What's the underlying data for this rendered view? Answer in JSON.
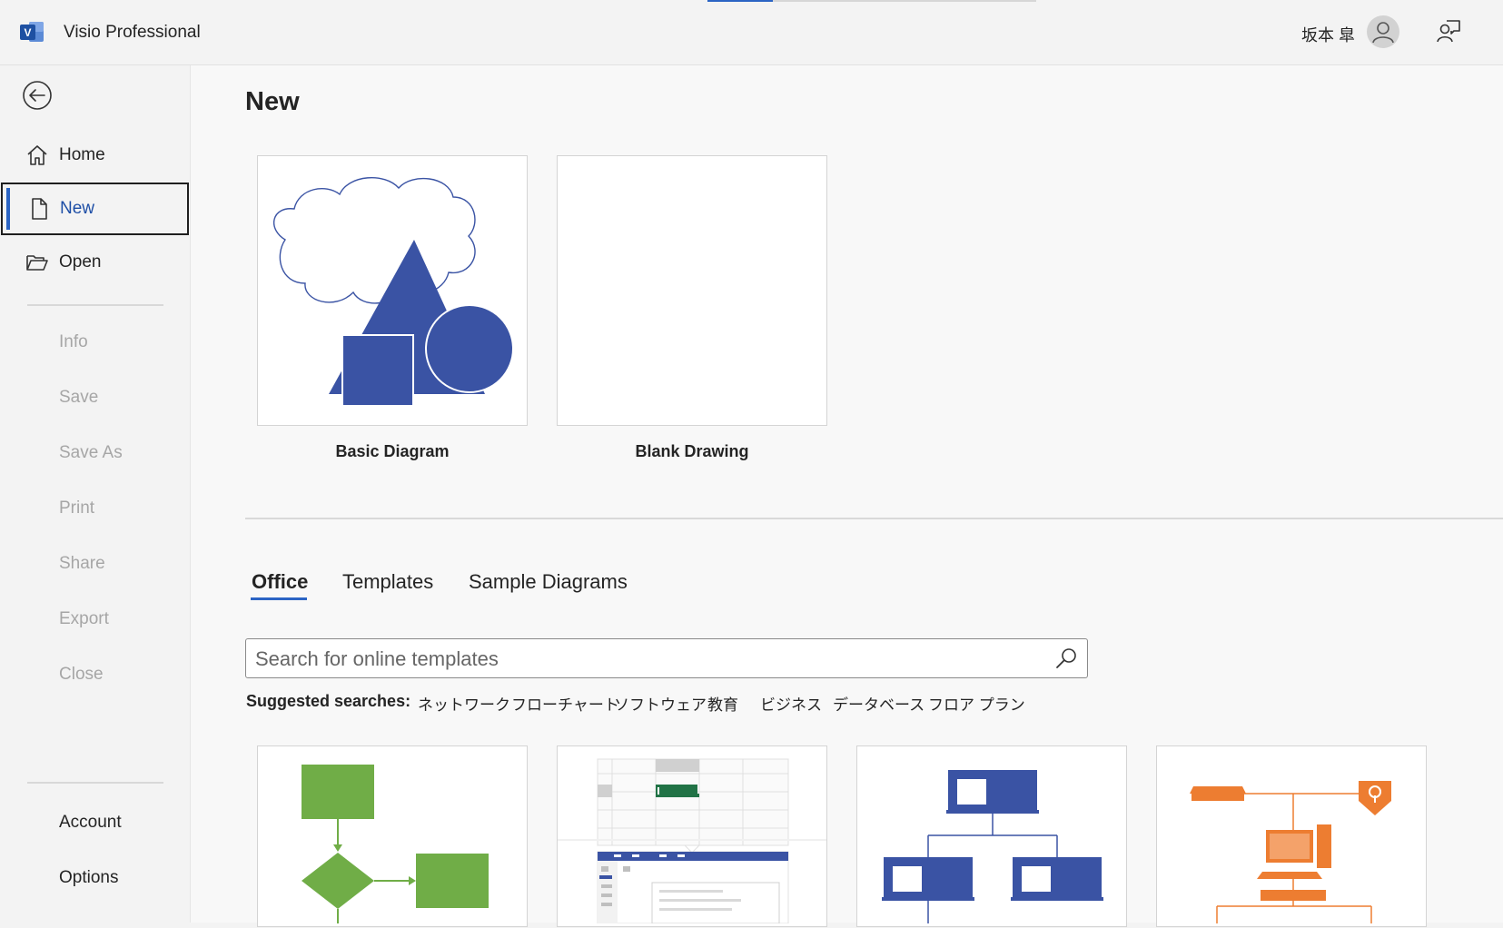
{
  "titlebar": {
    "app_name": "Visio Professional",
    "user_name": "坂本 皐",
    "progress_percent": 20,
    "logo_icon": "visio-logo-icon",
    "avatar_icon": "person-icon",
    "feedback_icon": "feedback-icon"
  },
  "sidebar": {
    "back_icon": "back-arrow-icon",
    "items": [
      {
        "label": "Home",
        "icon": "home-icon",
        "state": "normal"
      },
      {
        "label": "New",
        "icon": "new-document-icon",
        "state": "selected"
      },
      {
        "label": "Open",
        "icon": "open-folder-icon",
        "state": "normal"
      },
      {
        "label": "Info",
        "state": "disabled"
      },
      {
        "label": "Save",
        "state": "disabled"
      },
      {
        "label": "Save As",
        "state": "disabled"
      },
      {
        "label": "Print",
        "state": "disabled"
      },
      {
        "label": "Share",
        "state": "disabled"
      },
      {
        "label": "Export",
        "state": "disabled"
      },
      {
        "label": "Close",
        "state": "disabled"
      },
      {
        "label": "Account",
        "state": "normal"
      },
      {
        "label": "Options",
        "state": "normal"
      }
    ]
  },
  "main": {
    "title": "New",
    "featured": [
      {
        "label": "Basic Diagram"
      },
      {
        "label": "Blank Drawing"
      }
    ],
    "tabs": [
      {
        "label": "Office",
        "active": true
      },
      {
        "label": "Templates",
        "active": false
      },
      {
        "label": "Sample Diagrams",
        "active": false
      }
    ],
    "search": {
      "placeholder": "Search for online templates",
      "value": "",
      "icon": "search-icon"
    },
    "suggested_label": "Suggested searches:",
    "suggested": [
      "ネットワーク",
      "フローチャート",
      "ソフトウェア",
      "教育",
      "ビジネス",
      "データベース",
      "フロア プラン"
    ],
    "templates": [
      {
        "thumbnail": "flowchart-thumbnail"
      },
      {
        "thumbnail": "wireframe-thumbnail"
      },
      {
        "thumbnail": "org-chart-thumbnail"
      },
      {
        "thumbnail": "network-diagram-thumbnail"
      }
    ]
  },
  "colors": {
    "accent": "#2b64c4",
    "shape_blue": "#3a53a4",
    "flow_green": "#70ad47",
    "network_orange": "#ed7d31"
  }
}
